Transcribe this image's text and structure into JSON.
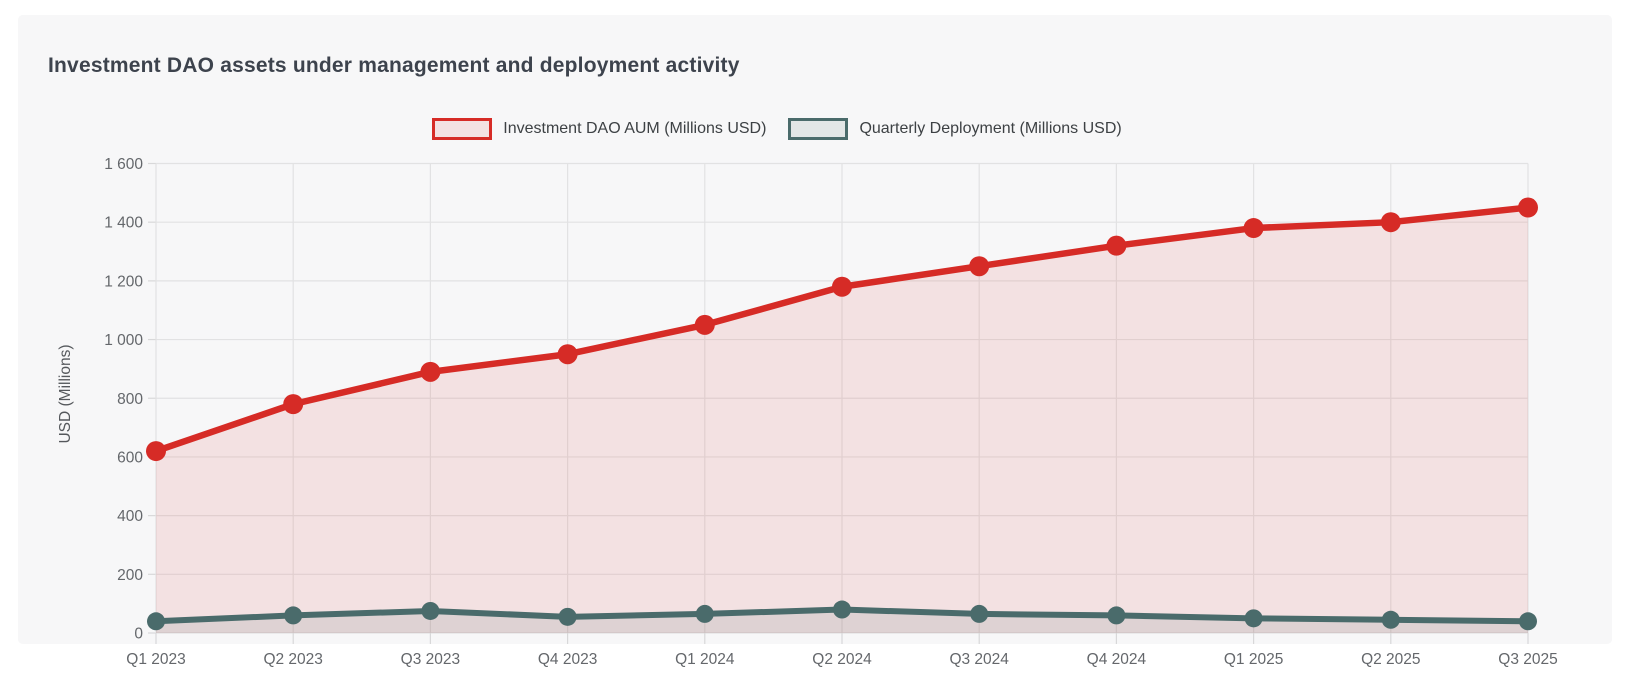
{
  "card": {
    "title": "Investment DAO assets under management and deployment activity"
  },
  "colors": {
    "page_bg": "#ffffff",
    "card_bg": "#f7f7f8",
    "grid": "#e2e2e3",
    "tick": "#d8d8d9",
    "tick_label": "#64676b",
    "title_text": "#3d434d",
    "axis_title_text": "#55585c",
    "legend_text": "#3d4144",
    "aum_red": "#d62b26",
    "deployment_teal": "#4a6b6b"
  },
  "chart_data": {
    "type": "line",
    "title": "Investment DAO assets under management and deployment activity",
    "xlabel": "",
    "ylabel": "USD (Millions)",
    "ylim": [
      0,
      1600
    ],
    "ytick_step": 200,
    "grid": true,
    "legend_position": "top",
    "categories": [
      "Q1 2023",
      "Q2 2023",
      "Q3 2023",
      "Q4 2023",
      "Q1 2024",
      "Q2 2024",
      "Q3 2024",
      "Q4 2024",
      "Q1 2025",
      "Q2 2025",
      "Q3 2025"
    ],
    "series": [
      {
        "name": "Investment DAO AUM (Millions USD)",
        "color": "#d62b26",
        "fill": "rgba(214,43,38,0.10)",
        "point_radius": 10,
        "values": [
          620,
          780,
          890,
          950,
          1050,
          1180,
          1250,
          1320,
          1380,
          1400,
          1450
        ]
      },
      {
        "name": "Quarterly Deployment (Millions USD)",
        "color": "#4a6b6b",
        "fill": "rgba(74,107,107,0.12)",
        "point_radius": 9,
        "values": [
          40,
          60,
          75,
          55,
          65,
          80,
          65,
          60,
          50,
          45,
          40
        ]
      }
    ]
  }
}
